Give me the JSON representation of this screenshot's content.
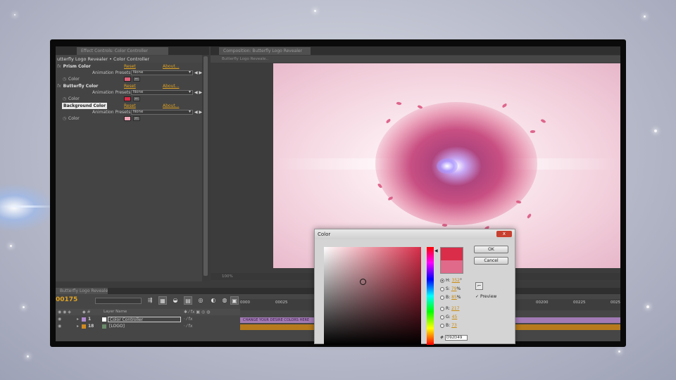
{
  "effect_controls": {
    "tabs": [
      "Effect Controls: Color Controller",
      "Composition: Butterfly Logo Revealer"
    ],
    "header": "utterfly Logo Revealer • Color Controller",
    "effects": [
      {
        "fx": "fx",
        "name": "Prism Color",
        "reset": "Reset",
        "about": "About...",
        "preset_label": "Animation Presets:",
        "preset_value": "None",
        "color_label": "Color",
        "swatch": "#e0607a"
      },
      {
        "fx": "fx",
        "name": "Butterfly Color",
        "reset": "Reset",
        "about": "About...",
        "preset_label": "Animation Presets:",
        "preset_value": "None",
        "color_label": "Color",
        "swatch": "#d92d49"
      },
      {
        "fx": "fx",
        "name": "Background Color",
        "reset": "Reset",
        "about": "About...",
        "preset_label": "Animation Presets:",
        "preset_value": "None",
        "color_label": "Color",
        "swatch": "#f0a8b8"
      }
    ]
  },
  "composition": {
    "sub_tab": "Butterfly Logo Reveale..",
    "zoom": "100%"
  },
  "timeline": {
    "tab": "Butterfly Logo Revealer",
    "timecode": "00175",
    "layer_header": "Layer Name",
    "ruler_ticks": [
      "0000",
      "00025",
      "00200",
      "00225",
      "0025"
    ],
    "layers": [
      {
        "num": "1",
        "name": "Color Controller",
        "chip": "#b08ad0"
      },
      {
        "num": "18",
        "name": "[LOGO]",
        "chip": "#d08a20"
      }
    ],
    "purple_bar_text": "CHANGE YOUR DESIRE COLORS HERE"
  },
  "color_dialog": {
    "title": "Color",
    "close": "x",
    "ok": "OK",
    "cancel": "Cancel",
    "preview_label": "Preview",
    "fields": [
      {
        "label": "H:",
        "value": "352",
        "unit": "°",
        "selected": true
      },
      {
        "label": "S:",
        "value": "79",
        "unit": "%",
        "selected": false
      },
      {
        "label": "B:",
        "value": "85",
        "unit": "%",
        "selected": false
      },
      {
        "label": "R:",
        "value": "217",
        "unit": "",
        "selected": false
      },
      {
        "label": "G:",
        "value": "45",
        "unit": "",
        "selected": false
      },
      {
        "label": "B:",
        "value": "73",
        "unit": "",
        "selected": false
      }
    ],
    "hex_label": "#",
    "hex_value": "D92D49",
    "current_color": "#d92d49",
    "original_color": "#e06a8a"
  }
}
